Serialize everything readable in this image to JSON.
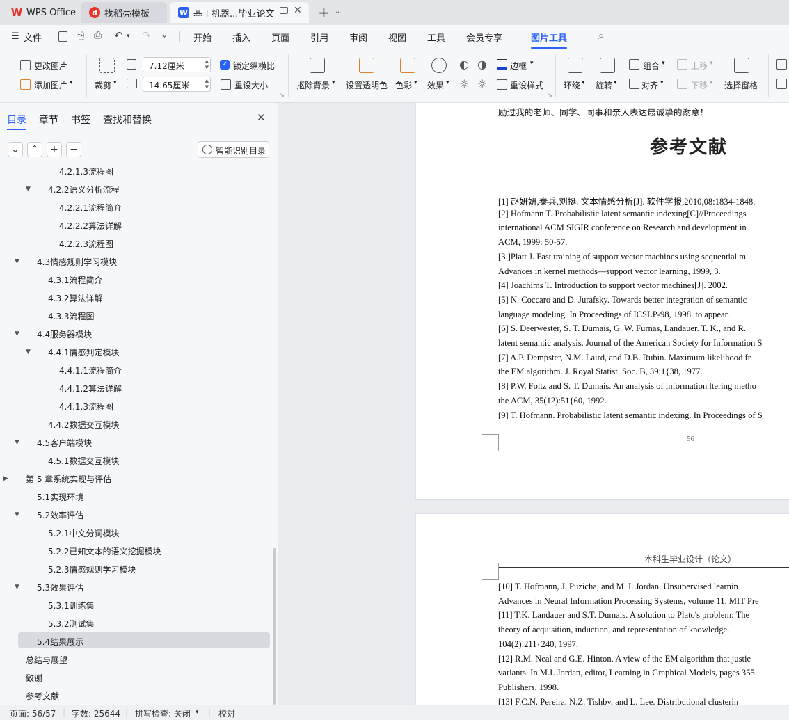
{
  "tabs": [
    {
      "label": "WPS Office",
      "icon": "wps-logo-icon"
    },
    {
      "label": "找稻壳模板",
      "icon": "docer-icon"
    },
    {
      "label": "基于机器...毕业论文",
      "icon": "word-doc-icon"
    }
  ],
  "menu": {
    "file": "文件",
    "items": [
      "开始",
      "插入",
      "页面",
      "引用",
      "审阅",
      "视图",
      "工具",
      "会员专享",
      "图片工具"
    ],
    "selected": "图片工具"
  },
  "ribbon": {
    "change_picture": "更改图片",
    "add_picture": "添加图片",
    "crop": "裁剪",
    "width_value": "7.12厘米",
    "height_value": "14.65厘米",
    "lock_ratio": "锁定纵横比",
    "reset_size": "重设大小",
    "remove_bg": "抠除背景",
    "set_transparent": "设置透明色",
    "color": "色彩",
    "effects": "效果",
    "border": "边框",
    "reset_style": "重设样式",
    "wrap": "环绕",
    "rotate": "旋转",
    "group": "组合",
    "align": "对齐",
    "bring_forward": "上移",
    "send_backward": "下移",
    "selection_pane": "选择窗格"
  },
  "nav": {
    "tabs": [
      "目录",
      "章节",
      "书签",
      "查找和替换"
    ],
    "smart_toc": "智能识别目录",
    "toc": [
      {
        "label": "4.2.1.3流程图",
        "level": 3,
        "expand": ""
      },
      {
        "label": "4.2.2语义分析流程",
        "level": 2,
        "expand": "open"
      },
      {
        "label": "4.2.2.1流程简介",
        "level": 3,
        "expand": ""
      },
      {
        "label": "4.2.2.2算法详解",
        "level": 3,
        "expand": ""
      },
      {
        "label": "4.2.2.3流程图",
        "level": 3,
        "expand": ""
      },
      {
        "label": "4.3情感规则学习模块",
        "level": 1,
        "expand": "open"
      },
      {
        "label": "4.3.1流程简介",
        "level": 2,
        "expand": ""
      },
      {
        "label": "4.3.2算法详解",
        "level": 2,
        "expand": ""
      },
      {
        "label": "4.3.3流程图",
        "level": 2,
        "expand": ""
      },
      {
        "label": "4.4服务器模块",
        "level": 1,
        "expand": "open"
      },
      {
        "label": "4.4.1情感判定模块",
        "level": 2,
        "expand": "open"
      },
      {
        "label": "4.4.1.1流程简介",
        "level": 3,
        "expand": ""
      },
      {
        "label": "4.4.1.2算法详解",
        "level": 3,
        "expand": ""
      },
      {
        "label": "4.4.1.3流程图",
        "level": 3,
        "expand": ""
      },
      {
        "label": "4.4.2数据交互模块",
        "level": 2,
        "expand": ""
      },
      {
        "label": "4.5客户端模块",
        "level": 1,
        "expand": "open"
      },
      {
        "label": "4.5.1数据交互模块",
        "level": 2,
        "expand": ""
      },
      {
        "label": "第 5 章系统实现与评估",
        "level": 0,
        "expand": "closed"
      },
      {
        "label": "5.1实现环境",
        "level": 1,
        "expand": ""
      },
      {
        "label": "5.2效率评估",
        "level": 1,
        "expand": "open"
      },
      {
        "label": "5.2.1中文分词模块",
        "level": 2,
        "expand": ""
      },
      {
        "label": "5.2.2已知文本的语义挖掘模块",
        "level": 2,
        "expand": ""
      },
      {
        "label": "5.2.3情感规则学习模块",
        "level": 2,
        "expand": ""
      },
      {
        "label": "5.3效果评估",
        "level": 1,
        "expand": "open"
      },
      {
        "label": "5.3.1训练集",
        "level": 2,
        "expand": ""
      },
      {
        "label": "5.3.2测试集",
        "level": 2,
        "expand": ""
      },
      {
        "label": "5.4结果展示",
        "level": 1,
        "expand": "",
        "selected": true
      },
      {
        "label": "总结与展望",
        "level": 0,
        "expand": ""
      },
      {
        "label": "致谢",
        "level": 0,
        "expand": ""
      },
      {
        "label": "参考文献",
        "level": 0,
        "expand": ""
      }
    ]
  },
  "doc": {
    "page1_top_text": "励过我的老师、同学、同事和亲人表达最诚挚的谢意！",
    "heading": "参考文献",
    "page1_lines": [
      "[1] 赵妍妍,秦兵,刘挺. 文本情感分析[J]. 软件学报,2010,08:1834-1848.",
      "[2]  Hofmann  T.  Probabilistic  latent  semantic  indexing[C]//Proceedings",
      "international  ACM  SIGIR  conference  on  Research  and  development  in",
      "ACM, 1999: 50-57.",
      "[3 ]Platt J. Fast training of support vector machines using sequential m",
      "Advances in kernel methods—support vector learning, 1999, 3.",
      "[4] Joachims T. Introduction to support vector machines[J]. 2002.",
      "[5] N. Coccaro and D. Jurafsky. Towards better integration of semantic",
      "language modeling. In Proceedings of ICSLP-98, 1998. to appear.",
      "[6] S. Deerwester, S. T. Dumais, G. W. Furnas, Landauer. T. K., and R.",
      "latent semantic analysis. Journal of the American Society for Information S",
      "[7] A.P. Dempster, N.M. Laird, and D.B. Rubin. Maximum likelihood fr",
      "the EM algorithm. J. Royal Statist. Soc. B, 39:1{38, 1977.",
      "[8] P.W. Foltz and S. T. Dumais. An analysis of information ltering metho",
      "the ACM, 35(12):51{60, 1992.",
      "[9] T. Hofmann. Probabilistic latent semantic indexing. In Proceedings of S"
    ],
    "page_number": "56",
    "page2_header": "本科生毕业设计（论文）",
    "page2_lines": [
      "[10]  T.  Hofmann,  J.  Puzicha,  and  M.  I.  Jordan.  Unsupervised  learnin",
      "Advances in Neural Information Processing Systems, volume 11. MIT Pre",
      "[11] T.K. Landauer and S.T. Dumais. A solution to Plato's problem: The",
      "theory  of  acquisition,  induction,  and  representation  of  knowledge.",
      "104(2):211{240, 1997.",
      "[12] R.M. Neal and G.E. Hinton. A view of the EM algorithm that justie",
      "variants. In M.I. Jordan, editor, Learning in Graphical Models, pages 355",
      "Publishers, 1998.",
      "[13]  F.C.N.  Pereira,  N.Z.  Tishby,  and  L.  Lee.  Distributional  clusterin"
    ]
  },
  "status": {
    "page": "页面: 56/57",
    "words": "字数: 25644",
    "spell": "拼写检查: 关闭",
    "proof": "校对"
  },
  "colors": {
    "accent": "#2b62f4",
    "wps_red": "#e8352b"
  }
}
